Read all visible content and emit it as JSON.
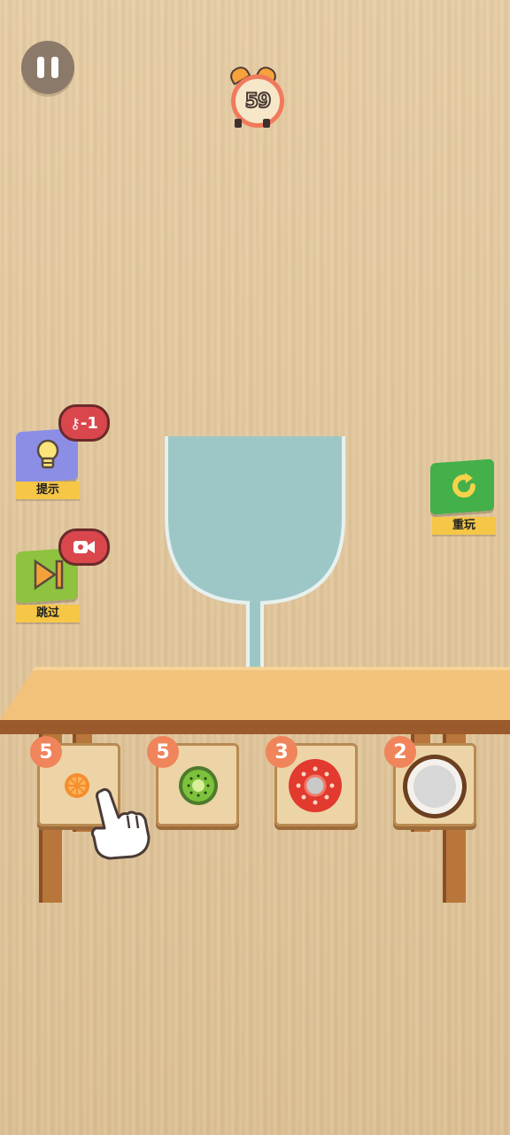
{
  "hud": {
    "timer": "59"
  },
  "left_actions": [
    {
      "label": "提示",
      "bubble": "-1",
      "icon": "lightbulb-icon",
      "bubble_icon": "key-icon"
    },
    {
      "label": "跳过",
      "icon": "skip-icon",
      "bubble_icon": "video-icon"
    }
  ],
  "right_actions": [
    {
      "label": "重玩",
      "icon": "replay-icon"
    }
  ],
  "fruits": [
    {
      "name": "orange",
      "count": "5",
      "color": "#f68d2e"
    },
    {
      "name": "kiwi",
      "count": "5",
      "color": "#7cc23b"
    },
    {
      "name": "tomato",
      "count": "3",
      "color": "#e23a2f"
    },
    {
      "name": "coconut",
      "count": "2",
      "color": "#f4f1ed"
    }
  ],
  "colors": {
    "glass_water": "#9dc7c6",
    "glass_outline": "#e6f1ef",
    "label_bg": "#f6c646",
    "count_badge": "#f0845a"
  }
}
